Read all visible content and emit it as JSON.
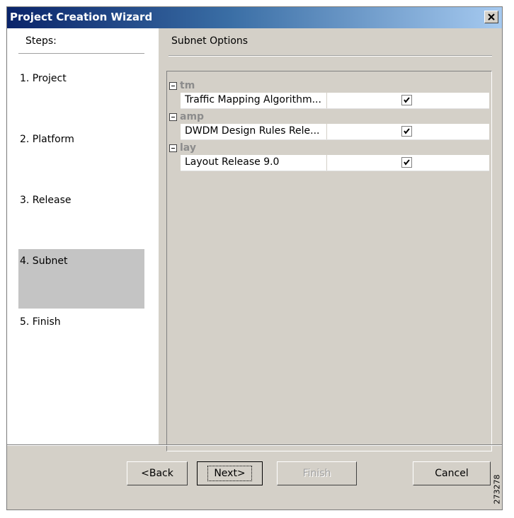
{
  "window": {
    "title": "Project Creation Wizard"
  },
  "steps": {
    "header": "Steps:",
    "items": [
      {
        "label": "1. Project"
      },
      {
        "label": "2. Platform"
      },
      {
        "label": "3. Release"
      },
      {
        "label": "4. Subnet",
        "active": true
      },
      {
        "label": "5. Finish"
      }
    ]
  },
  "main": {
    "title": "Subnet Options",
    "groups": [
      {
        "name": "tm",
        "item": {
          "label": "Traffic Mapping Algorithm...",
          "checked": true
        }
      },
      {
        "name": "amp",
        "item": {
          "label": "DWDM Design Rules Rele...",
          "checked": true
        }
      },
      {
        "name": "lay",
        "item": {
          "label": "Layout Release 9.0",
          "checked": true
        }
      }
    ]
  },
  "buttons": {
    "back": "<Back",
    "next": "Next>",
    "finish": "Finish",
    "cancel": "Cancel"
  },
  "watermark": "273278",
  "colors": {
    "title_gradient_start": "#0a246a",
    "title_gradient_end": "#a6caf0",
    "dialog_bg": "#d4d0c8",
    "active_step": "#c4c4c4"
  }
}
